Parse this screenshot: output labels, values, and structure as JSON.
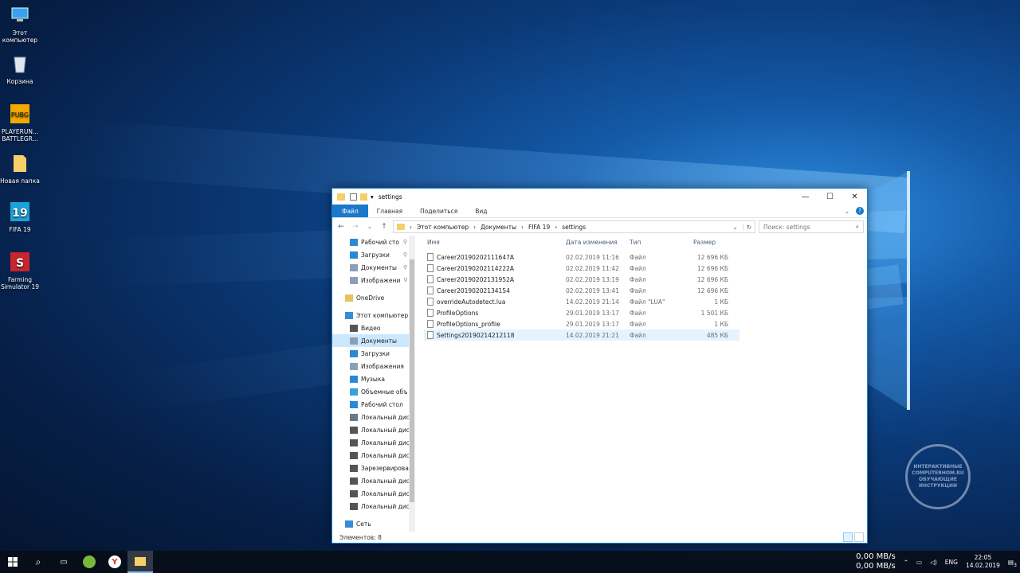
{
  "desktop": {
    "icons": [
      {
        "label": "Этот компьютер",
        "icon": "computer-icon"
      },
      {
        "label": "Корзина",
        "icon": "recycle-bin-icon"
      },
      {
        "label": "PLAYERUN... BATTLEGR...",
        "icon": "pubg-icon"
      },
      {
        "label": "Новая папка",
        "icon": "folder-icon"
      },
      {
        "label": "FIFA 19",
        "icon": "fifa-icon"
      },
      {
        "label": "Farming Simulator 19",
        "icon": "farming-simulator-icon"
      }
    ]
  },
  "explorer": {
    "title": "settings",
    "ribbon": {
      "file": "Файл",
      "home": "Главная",
      "share": "Поделиться",
      "view": "Вид"
    },
    "breadcrumb": [
      "Этот компьютер",
      "Документы",
      "FIFA 19",
      "settings"
    ],
    "search_placeholder": "Поиск: settings",
    "columns": {
      "name": "Имя",
      "date": "Дата изменения",
      "type": "Тип",
      "size": "Размер"
    },
    "nav": [
      {
        "label": "Рабочий сто",
        "pinned": true,
        "color": "#2a88d8"
      },
      {
        "label": "Загрузки",
        "pinned": true,
        "color": "#2a88d8"
      },
      {
        "label": "Документы",
        "pinned": true,
        "color": "#8aa0b8"
      },
      {
        "label": "Изображени",
        "pinned": true,
        "color": "#8aa0b8"
      },
      {
        "label": "OneDrive",
        "pinned": false,
        "color": "#e8c25a"
      },
      {
        "label": "Этот компьютер",
        "pinned": false,
        "color": "#3a8ad8"
      },
      {
        "label": "Видео",
        "pinned": false,
        "color": "#555"
      },
      {
        "label": "Документы",
        "pinned": false,
        "color": "#8aa0b8",
        "selected": true
      },
      {
        "label": "Загрузки",
        "pinned": false,
        "color": "#2a88d8"
      },
      {
        "label": "Изображения",
        "pinned": false,
        "color": "#8aa0b8"
      },
      {
        "label": "Музыка",
        "pinned": false,
        "color": "#2a88d8"
      },
      {
        "label": "Объемные объ",
        "pinned": false,
        "color": "#39a0d8"
      },
      {
        "label": "Рабочий стол",
        "pinned": false,
        "color": "#2a88d8"
      },
      {
        "label": "Локальный дис",
        "pinned": false,
        "color": "#6a7a8a"
      },
      {
        "label": "Локальный дис",
        "pinned": false,
        "color": "#555"
      },
      {
        "label": "Локальный дис",
        "pinned": false,
        "color": "#555"
      },
      {
        "label": "Локальный дис",
        "pinned": false,
        "color": "#555"
      },
      {
        "label": "Зарезервирова",
        "pinned": false,
        "color": "#555"
      },
      {
        "label": "Локальный дис",
        "pinned": false,
        "color": "#555"
      },
      {
        "label": "Локальный дис",
        "pinned": false,
        "color": "#555"
      },
      {
        "label": "Локальный дис",
        "pinned": false,
        "color": "#555"
      },
      {
        "label": "Сеть",
        "pinned": false,
        "color": "#3a8ad8"
      }
    ],
    "files": [
      {
        "name": "Career20190202111647A",
        "date": "02.02.2019 11:16",
        "type": "Файл",
        "size": "12 696 КБ"
      },
      {
        "name": "Career20190202114222A",
        "date": "02.02.2019 11:42",
        "type": "Файл",
        "size": "12 696 КБ"
      },
      {
        "name": "Career20190202131952A",
        "date": "02.02.2019 13:19",
        "type": "Файл",
        "size": "12 696 КБ"
      },
      {
        "name": "Career20190202134154",
        "date": "02.02.2019 13:41",
        "type": "Файл",
        "size": "12 696 КБ"
      },
      {
        "name": "overrideAutodetect.lua",
        "date": "14.02.2019 21:14",
        "type": "Файл \"LUA\"",
        "size": "1 КБ"
      },
      {
        "name": "ProfileOptions",
        "date": "29.01.2019 13:17",
        "type": "Файл",
        "size": "1 501 КБ"
      },
      {
        "name": "ProfileOptions_profile",
        "date": "29.01.2019 13:17",
        "type": "Файл",
        "size": "1 КБ"
      },
      {
        "name": "Settings20190214212118",
        "date": "14.02.2019 21:21",
        "type": "Файл",
        "size": "485 КБ",
        "selected": true
      }
    ],
    "status": "Элементов: 8"
  },
  "taskbar": {
    "net_up": "0,00 MB/s",
    "net_down": "0,00 MB/s",
    "lang": "ENG",
    "time": "22:05",
    "date": "14.02.2019",
    "notifications": "3"
  },
  "watermark": "ИНТЕРАКТИВНЫЕ COMPUTERHOM.RU ОБУЧАЮЩИЕ ИНСТРУКЦИИ"
}
